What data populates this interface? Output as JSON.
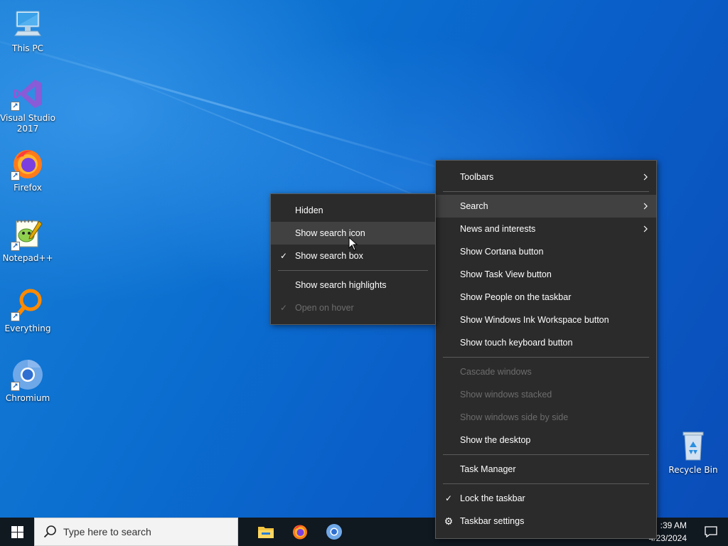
{
  "desktop": {
    "icons": [
      {
        "label": "This PC"
      },
      {
        "label": "Visual Studio 2017"
      },
      {
        "label": "Firefox"
      },
      {
        "label": "Notepad++"
      },
      {
        "label": "Everything"
      },
      {
        "label": "Chromium"
      },
      {
        "label": "Recycle Bin"
      }
    ]
  },
  "search_submenu": {
    "items": [
      {
        "label": "Hidden",
        "checked": false,
        "state": "normal"
      },
      {
        "label": "Show search icon",
        "checked": false,
        "state": "hover"
      },
      {
        "label": "Show search box",
        "checked": true,
        "state": "normal"
      },
      {
        "label": "Show search highlights",
        "checked": false,
        "state": "normal"
      },
      {
        "label": "Open on hover",
        "checked": true,
        "state": "disabled"
      }
    ],
    "check_glyph": "✓"
  },
  "taskbar_menu": {
    "items": [
      {
        "label": "Toolbars",
        "submenu": true
      },
      {
        "label": "Search",
        "submenu": true,
        "state": "hover"
      },
      {
        "label": "News and interests",
        "submenu": true
      },
      {
        "label": "Show Cortana button"
      },
      {
        "label": "Show Task View button"
      },
      {
        "label": "Show People on the taskbar"
      },
      {
        "label": "Show Windows Ink Workspace button"
      },
      {
        "label": "Show touch keyboard button"
      },
      {
        "label": "Cascade windows",
        "state": "disabled"
      },
      {
        "label": "Show windows stacked",
        "state": "disabled"
      },
      {
        "label": "Show windows side by side",
        "state": "disabled"
      },
      {
        "label": "Show the desktop"
      },
      {
        "label": "Task Manager"
      },
      {
        "label": "Lock the taskbar",
        "checked": true
      },
      {
        "label": "Taskbar settings",
        "icon": "gear-icon"
      }
    ],
    "check_glyph": "✓",
    "gear_glyph": "⚙"
  },
  "taskbar": {
    "search_placeholder": "Type here to search",
    "clock_time": ":39 AM",
    "clock_date": "4/23/2024",
    "apps": [
      "file-explorer-icon",
      "firefox-icon",
      "chromium-icon"
    ]
  },
  "colors": {
    "menu_bg": "#2b2b2b",
    "menu_hover": "#414141",
    "menu_disabled_text": "#6d6d6d",
    "taskbar_bg": "#101820",
    "desktop_blue": "#0a6fd0"
  }
}
